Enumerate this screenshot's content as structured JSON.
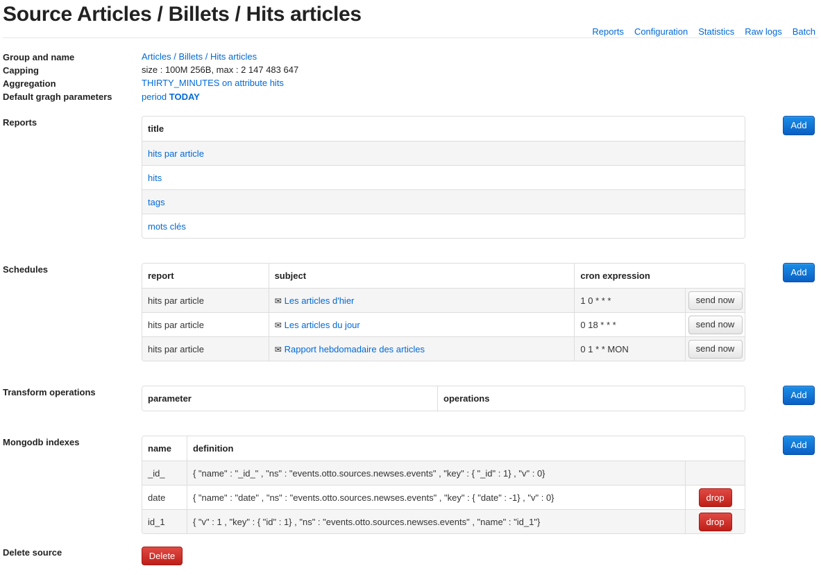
{
  "page": {
    "title": "Source Articles / Billets / Hits articles",
    "nav": [
      "Reports",
      "Configuration",
      "Statistics",
      "Raw logs",
      "Batch"
    ]
  },
  "info": {
    "group_label": "Group and name",
    "group_value": "Articles / Billets / Hits articles",
    "capping_label": "Capping",
    "capping_value": "size : 100M 256B, max : 2 147 483 647",
    "aggregation_label": "Aggregation",
    "aggregation_value": "THIRTY_MINUTES on attribute hits",
    "graph_label": "Default gragh parameters",
    "graph_prefix": "period",
    "graph_period": "TODAY"
  },
  "reports": {
    "label": "Reports",
    "add": "Add",
    "header": "title",
    "rows": [
      "hits par article",
      "hits",
      "tags",
      "mots clés"
    ]
  },
  "schedules": {
    "label": "Schedules",
    "add": "Add",
    "headers": [
      "report",
      "subject",
      "cron expression"
    ],
    "send_label": "send now",
    "rows": [
      {
        "report": "hits par article",
        "subject": "Les articles d'hier",
        "cron": "1 0 * * *"
      },
      {
        "report": "hits par article",
        "subject": "Les articles du jour",
        "cron": "0 18 * * *"
      },
      {
        "report": "hits par article",
        "subject": "Rapport hebdomadaire des articles",
        "cron": "0 1 * * MON"
      }
    ]
  },
  "transforms": {
    "label": "Transform operations",
    "add": "Add",
    "headers": [
      "parameter",
      "operations"
    ]
  },
  "indexes": {
    "label": "Mongodb indexes",
    "add": "Add",
    "headers": [
      "name",
      "definition"
    ],
    "drop_label": "drop",
    "rows": [
      {
        "name": "_id_",
        "definition": "{ \"name\" : \"_id_\" , \"ns\" : \"events.otto.sources.newses.events\" , \"key\" : { \"_id\" : 1} , \"v\" : 0}",
        "droppable": false
      },
      {
        "name": "date",
        "definition": "{ \"name\" : \"date\" , \"ns\" : \"events.otto.sources.newses.events\" , \"key\" : { \"date\" : -1} , \"v\" : 0}",
        "droppable": true
      },
      {
        "name": "id_1",
        "definition": "{ \"v\" : 1 , \"key\" : { \"id\" : 1} , \"ns\" : \"events.otto.sources.newses.events\" , \"name\" : \"id_1\"}",
        "droppable": true
      }
    ]
  },
  "delete": {
    "label": "Delete source",
    "button": "Delete"
  },
  "icons": {
    "subject": "envelope-icon"
  },
  "colors": {
    "link": "#0069d6",
    "primary": "#0a5fc4",
    "danger": "#bf1f18"
  }
}
